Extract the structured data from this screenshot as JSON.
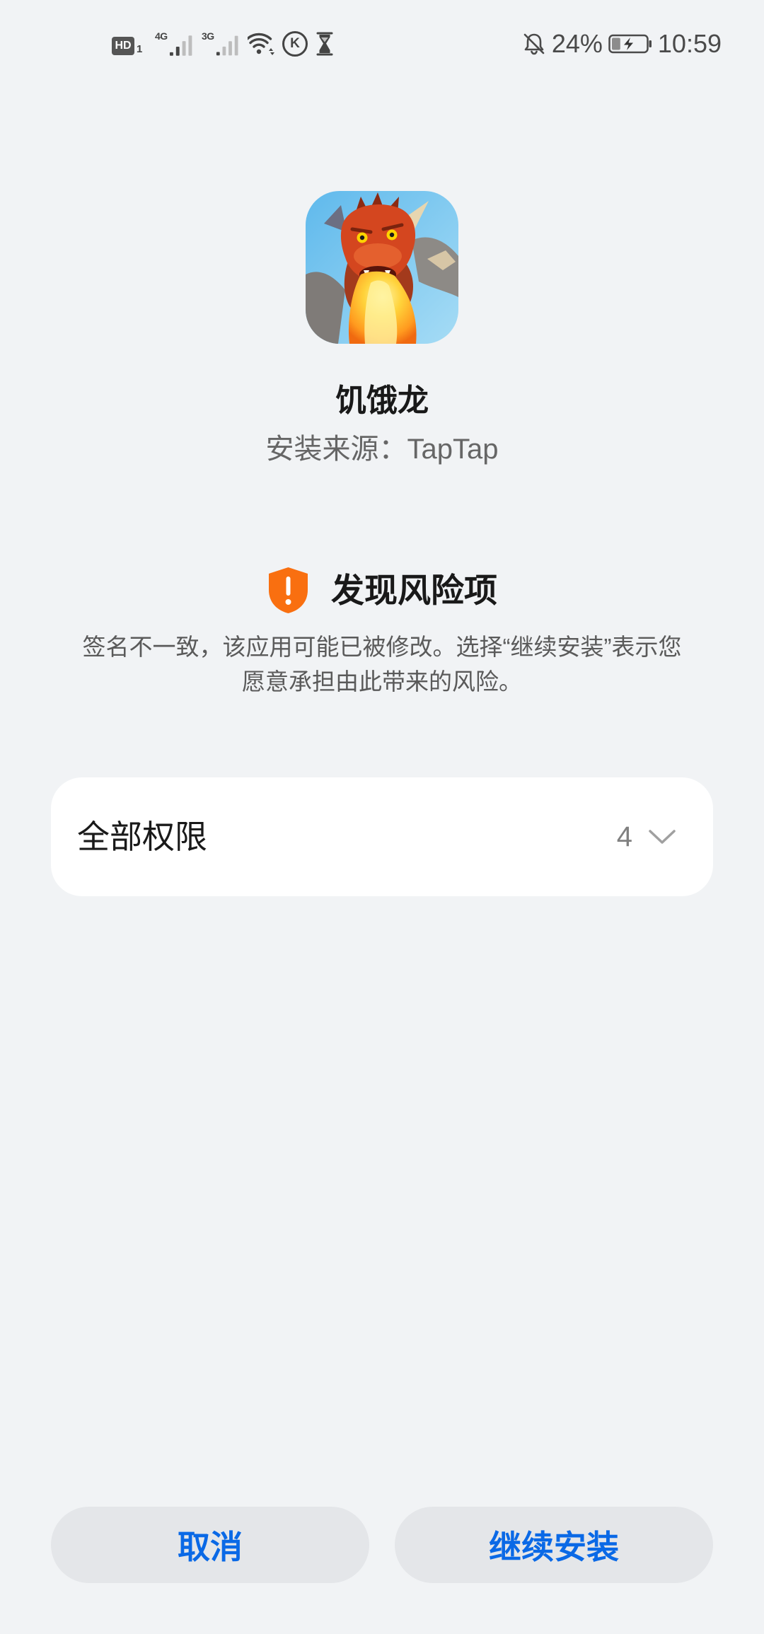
{
  "status_bar": {
    "hd_label": "HD",
    "hd_sim": "1",
    "sim1": {
      "network": "4G",
      "signal_level": 2
    },
    "sim2": {
      "network": "3G",
      "signal_level": 1
    },
    "notification_badge_letter": "K",
    "battery_percent": "24%",
    "battery_level": 0.24,
    "charging": true,
    "time": "10:59",
    "icons": {
      "hd": "hd-voice-icon",
      "sim1": "signal-icon",
      "sim2": "signal-icon",
      "wifi": "wifi-icon",
      "notification": "k-app-icon",
      "hourglass": "hourglass-icon",
      "silent": "bell-off-icon",
      "battery": "battery-charging-icon"
    }
  },
  "app": {
    "icon": "dragon-app-icon",
    "name": "饥饿龙",
    "source": "安装来源：TapTap"
  },
  "risk": {
    "icon": "shield-warning-icon",
    "title": "发现风险项",
    "description_lines": [
      "签名不一致，该应用可能已被修改。选择“继续安装”表示您",
      "愿意承担由此带来的风险。"
    ]
  },
  "permissions": {
    "label": "全部权限",
    "count": "4",
    "icon": "chevron-down-icon"
  },
  "actions": {
    "cancel_label": "取消",
    "continue_label": "继续安装"
  },
  "theme": {
    "background": "#f1f3f5",
    "accent": "#0a69e6",
    "warning": "#f96f10",
    "card": "#ffffff",
    "button": "#e4e6e9"
  }
}
